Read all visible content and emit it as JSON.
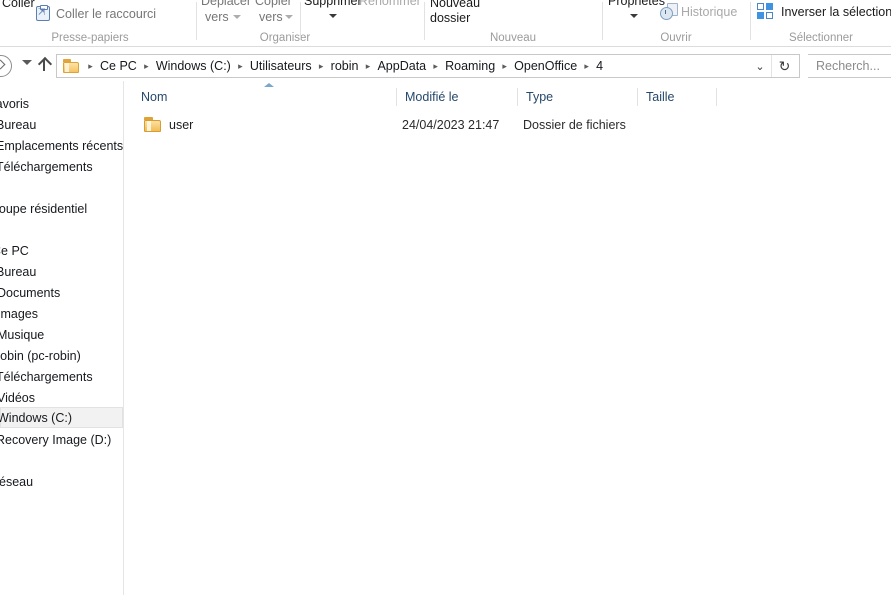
{
  "ribbon": {
    "groups": [
      {
        "label": "Presse-papiers"
      },
      {
        "label": "Organiser"
      },
      {
        "label": "Nouveau"
      },
      {
        "label": "Ouvrir"
      },
      {
        "label": "Sélectionner"
      }
    ],
    "paste_label": "Coller",
    "paste_shortcut_label": "Coller le raccourci",
    "paste_shortcut_icon": "clipboard-shortcut-icon",
    "move_to_label": "Déplacer",
    "move_to_label2": "vers",
    "copy_to_label": "Copier",
    "copy_to_label2": "vers",
    "delete_label": "Supprimer",
    "rename_label": "Renommer",
    "new_folder_label": "Nouveau",
    "new_folder_label2": "dossier",
    "properties_label": "Propriétés",
    "history_label": "Historique",
    "history_icon": "history-clock-icon",
    "invert_selection_label": "Inverser la sélection",
    "invert_selection_icon": "invert-selection-icon"
  },
  "address": {
    "forward_icon": "forward-arrow-icon",
    "history_dropdown_icon": "chevron-down-icon",
    "up_icon": "up-arrow-icon",
    "folder_icon": "folder-icon",
    "separator": "▸",
    "crumbs": [
      "Ce PC",
      "Windows (C:)",
      "Utilisateurs",
      "robin",
      "AppData",
      "Roaming",
      "OpenOffice",
      "4"
    ],
    "dropdown_icon": "chevron-down-icon",
    "refresh_icon": "refresh-icon",
    "refresh_glyph": "↻",
    "search_placeholder": "Recherch..."
  },
  "sidebar": {
    "items": [
      {
        "label": "Favoris",
        "selected": false
      },
      {
        "label": "Bureau",
        "selected": false
      },
      {
        "label": "Emplacements récents",
        "selected": false
      },
      {
        "label": "Téléchargements",
        "selected": false
      },
      {
        "label": "Groupe résidentiel",
        "selected": false
      },
      {
        "label": "Ce PC",
        "selected": false
      },
      {
        "label": "Bureau",
        "selected": false
      },
      {
        "label": "Documents",
        "selected": false
      },
      {
        "label": "Images",
        "selected": false
      },
      {
        "label": "Musique",
        "selected": false
      },
      {
        "label": "robin (pc-robin)",
        "selected": false
      },
      {
        "label": "Téléchargements",
        "selected": false
      },
      {
        "label": "Vidéos",
        "selected": false
      },
      {
        "label": "Windows (C:)",
        "selected": true
      },
      {
        "label": "Recovery Image (D:)",
        "selected": false
      },
      {
        "label": "Réseau",
        "selected": false
      }
    ]
  },
  "filelist": {
    "columns": [
      {
        "label": "Nom"
      },
      {
        "label": "Modifié le"
      },
      {
        "label": "Type"
      },
      {
        "label": "Taille"
      }
    ],
    "sort_indicator": "sort-ascending-icon",
    "rows": [
      {
        "icon": "folder-icon",
        "name": "user",
        "modified": "24/04/2023 21:47",
        "type": "Dossier de fichiers",
        "size": ""
      }
    ]
  },
  "colors": {
    "accent": "#3f93e0",
    "column_header_text": "#25486b",
    "folder": "#f3bd57",
    "selection_bg": "#f2f2f2"
  }
}
